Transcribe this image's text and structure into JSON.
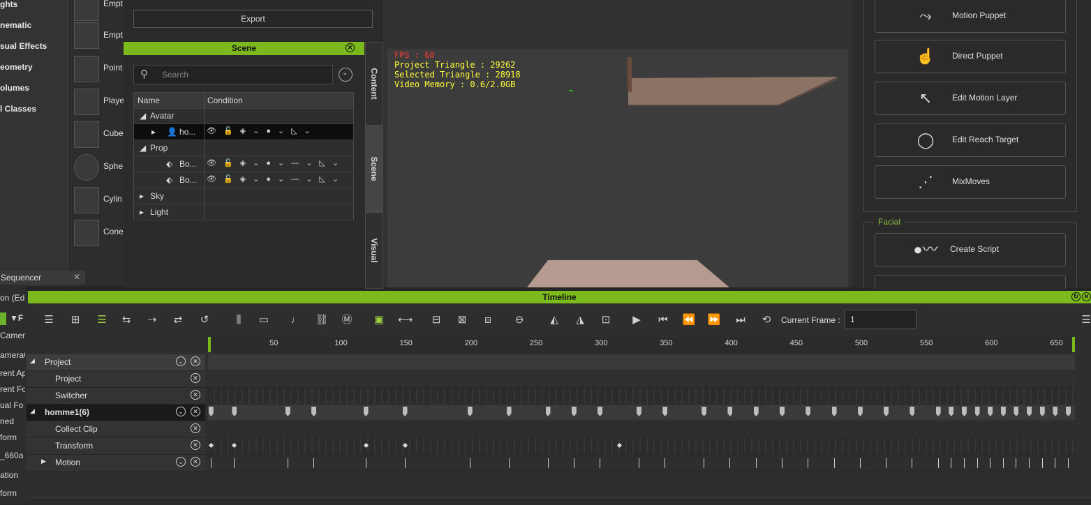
{
  "categories": [
    "ghts",
    "nematic",
    "sual Effects",
    "eometry",
    "olumes",
    "l Classes"
  ],
  "thumbs": [
    "Empt",
    "Empt",
    "Point",
    "Playe",
    "Cube",
    "Sphe",
    "Cylin",
    "Cone"
  ],
  "export_label": "Export",
  "scene": {
    "title": "Scene",
    "search_placeholder": "Search",
    "col_name": "Name",
    "col_condition": "Condition",
    "rows": [
      "Avatar",
      "ho...",
      "Prop",
      "Bo...",
      "Bo...",
      "Sky",
      "Light"
    ]
  },
  "side_tabs": [
    "Content",
    "Scene",
    "Visual"
  ],
  "viewport": {
    "fps": "FPS : 60",
    "project_triangle": "Project Triangle : 29262",
    "selected_triangle": "Selected Triangle : 28918",
    "video_memory": "Video Memory : 0.6/2.0GB"
  },
  "right_buttons": [
    "Motion Puppet",
    "Direct Puppet",
    "Edit Motion Layer",
    "Edit Reach Target",
    "MixMoves"
  ],
  "facial": {
    "label": "Facial",
    "create_script": "Create Script"
  },
  "sequencer": {
    "tab": "Sequencer",
    "items": [
      "on (Edi",
      "F",
      "Camer",
      "ameraC",
      "rent Ap",
      "rent Fo",
      "ual Fo",
      "ned",
      "form",
      "_660a",
      "ation",
      "form"
    ]
  },
  "timeline": {
    "title": "Timeline",
    "current_frame_label": "Current Frame :",
    "current_frame": "1",
    "ruler": [
      "50",
      "100",
      "150",
      "200",
      "250",
      "300",
      "350",
      "400",
      "450",
      "500",
      "550",
      "600",
      "650"
    ],
    "tracks": [
      "Project",
      "Project",
      "Switcher",
      "homme1(6)",
      "Collect Clip",
      "Transform",
      "Motion"
    ],
    "keys_main": [
      1,
      19,
      60,
      80,
      120,
      150,
      200,
      230,
      260,
      280,
      300,
      330,
      350,
      380,
      400,
      420,
      440,
      460,
      480,
      500,
      520,
      540,
      560,
      570,
      580,
      590,
      600,
      610,
      620,
      630,
      640,
      650,
      660
    ],
    "keys_transform": [
      1,
      19,
      120,
      150,
      315
    ],
    "frame_max": 660
  },
  "colors": {
    "accent": "#7cb91c",
    "stats": "#ffff3a"
  }
}
